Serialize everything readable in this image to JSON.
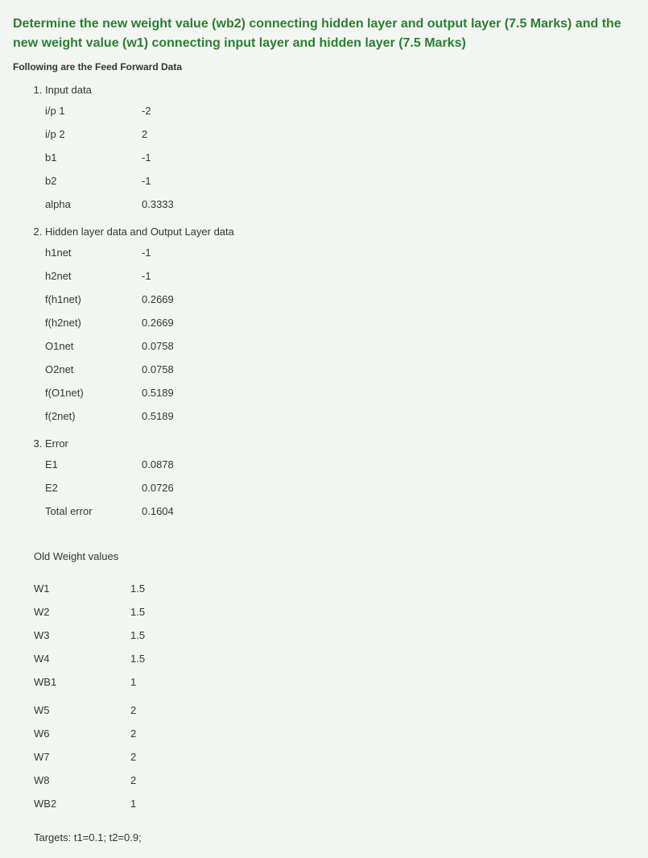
{
  "title": "Determine the new weight value (wb2) connecting hidden layer and output layer (7.5 Marks) and the new weight value (w1) connecting input layer and hidden layer (7.5 Marks)",
  "intro": "Following are the Feed Forward Data",
  "sections": {
    "s1": {
      "label": "Input data",
      "rows": [
        {
          "k": "i/p 1",
          "v": "-2"
        },
        {
          "k": "i/p 2",
          "v": "2"
        },
        {
          "k": "b1",
          "v": "-1"
        },
        {
          "k": "b2",
          "v": "-1"
        },
        {
          "k": "alpha",
          "v": "0.3333"
        }
      ]
    },
    "s2": {
      "label": "Hidden layer data and Output Layer data",
      "rows": [
        {
          "k": "h1net",
          "v": "-1"
        },
        {
          "k": "h2net",
          "v": "-1"
        },
        {
          "k": "f(h1net)",
          "v": "0.2669"
        },
        {
          "k": "f(h2net)",
          "v": "0.2669"
        },
        {
          "k": "O1net",
          "v": "0.0758"
        },
        {
          "k": "O2net",
          "v": "0.0758"
        },
        {
          "k": "f(O1net)",
          "v": "0.5189"
        },
        {
          "k": "f(2net)",
          "v": "0.5189"
        }
      ]
    },
    "s3": {
      "label": "Error",
      "rows": [
        {
          "k": "E1",
          "v": "0.0878"
        },
        {
          "k": "E2",
          "v": "0.0726"
        },
        {
          "k": "Total error",
          "v": "0.1604"
        }
      ]
    }
  },
  "oldWeightsHeading": "Old Weight values",
  "weightsA": [
    {
      "k": "W1",
      "v": "1.5"
    },
    {
      "k": "W2",
      "v": "1.5"
    },
    {
      "k": "W3",
      "v": "1.5"
    },
    {
      "k": "W4",
      "v": "1.5"
    },
    {
      "k": "WB1",
      "v": "1"
    }
  ],
  "weightsB": [
    {
      "k": "W5",
      "v": "2"
    },
    {
      "k": "W6",
      "v": "2"
    },
    {
      "k": "W7",
      "v": "2"
    },
    {
      "k": "W8",
      "v": "2"
    },
    {
      "k": "WB2",
      "v": "1"
    }
  ],
  "targets": "Targets: t1=0.1; t2=0.9;"
}
